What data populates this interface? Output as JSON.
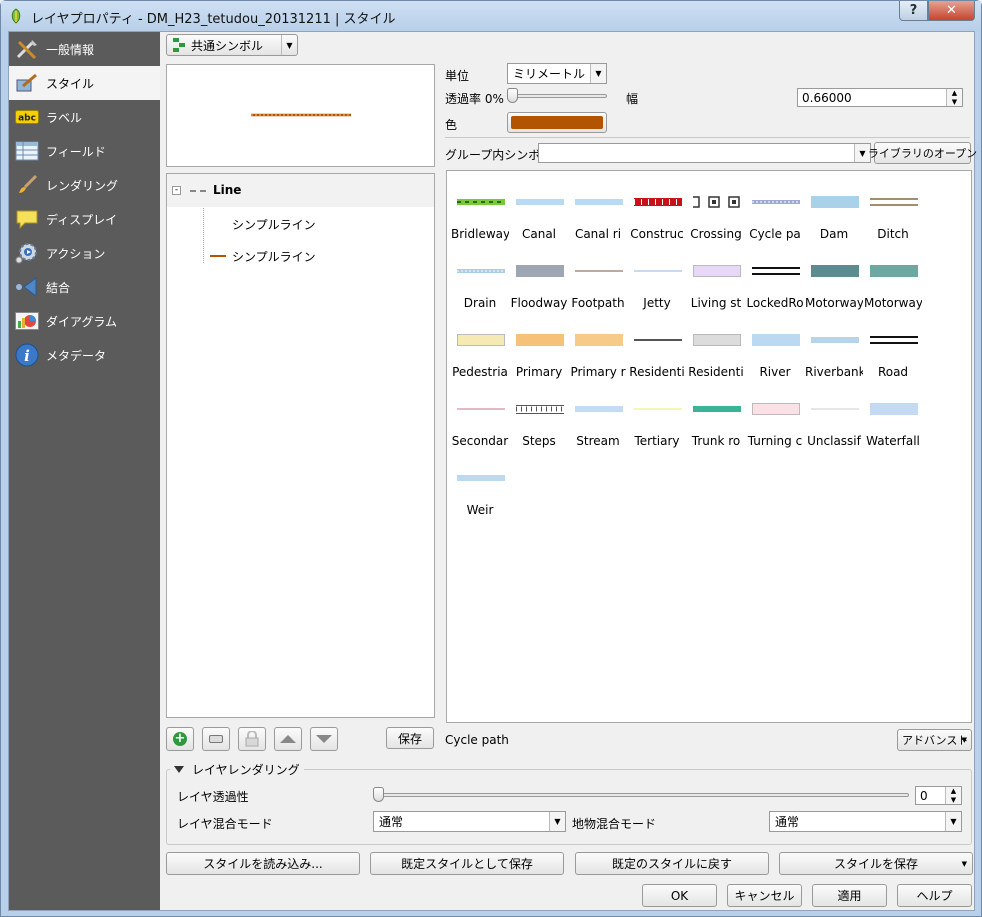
{
  "window": {
    "title": "レイヤプロパティ - DM_H23_tetudou_20131211 | スタイル",
    "help_label": "?",
    "close_label": "✕"
  },
  "sidebar": {
    "items": [
      {
        "label": "一般情報",
        "icon": "tools-icon"
      },
      {
        "label": "スタイル",
        "icon": "brush-style-icon"
      },
      {
        "label": "ラベル",
        "icon": "abc-label-icon"
      },
      {
        "label": "フィールド",
        "icon": "table-icon"
      },
      {
        "label": "レンダリング",
        "icon": "paintbrush-icon"
      },
      {
        "label": "ディスプレイ",
        "icon": "speech-bubble-icon"
      },
      {
        "label": "アクション",
        "icon": "gear-action-icon"
      },
      {
        "label": "結合",
        "icon": "join-arrow-icon"
      },
      {
        "label": "ダイアグラム",
        "icon": "diagram-icon"
      },
      {
        "label": "メタデータ",
        "icon": "info-icon"
      }
    ]
  },
  "renderer": {
    "type_label": "共通シンボル"
  },
  "tree": {
    "root": "Line",
    "children": [
      "シンプルライン",
      "シンプルライン"
    ]
  },
  "props": {
    "unit_label": "単位",
    "unit_value": "ミリメートル",
    "opacity_label": "透過率 0%",
    "width_label": "幅",
    "width_value": "0.66000",
    "color_label": "色",
    "color_value": "#b35400"
  },
  "group": {
    "label": "グループ内シンボル",
    "value": "",
    "library_button": "ライブラリのオープン"
  },
  "symbols": [
    {
      "name": "Bridleway",
      "color": "#78c83c",
      "style": "dash"
    },
    {
      "name": "Canal",
      "color": "#bcd9f2",
      "style": "solid"
    },
    {
      "name": "Canal ri",
      "color": "#bcd9f2",
      "style": "solid"
    },
    {
      "name": "Construc",
      "color": "#c8121a",
      "style": "blocks"
    },
    {
      "name": "Crossing",
      "color": "#333333",
      "style": "squares"
    },
    {
      "name": "Cycle pa",
      "color": "#a0a8d8",
      "style": "dots"
    },
    {
      "name": "Dam",
      "color": "#a9d2ea",
      "style": "thick"
    },
    {
      "name": "Ditch",
      "color": "#a58d70",
      "style": "double"
    },
    {
      "name": "Drain",
      "color": "#a8cfe0",
      "style": "dots"
    },
    {
      "name": "Floodway",
      "color": "#9ea6b4",
      "style": "thick"
    },
    {
      "name": "Footpath",
      "color": "#c0aaa0",
      "style": "thin"
    },
    {
      "name": "Jetty",
      "color": "#c8d8f0",
      "style": "thin"
    },
    {
      "name": "Living st",
      "color": "#e6d8f6",
      "style": "box"
    },
    {
      "name": "LockedRo",
      "color": "#111111",
      "style": "double"
    },
    {
      "name": "Motorway",
      "color": "#5d8c90",
      "style": "thick"
    },
    {
      "name": "Motorway",
      "color": "#6ea6a0",
      "style": "thick"
    },
    {
      "name": "Pedestria",
      "color": "#f6eab4",
      "style": "box"
    },
    {
      "name": "Primary",
      "color": "#f6c27a",
      "style": "thick"
    },
    {
      "name": "Primary r",
      "color": "#f8ca8a",
      "style": "thick"
    },
    {
      "name": "Residenti",
      "color": "#555555",
      "style": "thin"
    },
    {
      "name": "Residenti",
      "color": "#dcdcdc",
      "style": "box"
    },
    {
      "name": "River",
      "color": "#bcd9f2",
      "style": "thick"
    },
    {
      "name": "Riverbank",
      "color": "#b8d4ea",
      "style": "solid"
    },
    {
      "name": "Road",
      "color": "#111111",
      "style": "double"
    },
    {
      "name": "Secondar",
      "color": "#e6b8c4",
      "style": "thin"
    },
    {
      "name": "Steps",
      "color": "#555555",
      "style": "ticks"
    },
    {
      "name": "Stream",
      "color": "#c4dcf2",
      "style": "solid"
    },
    {
      "name": "Tertiary",
      "color": "#f6f6b8",
      "style": "thin"
    },
    {
      "name": "Trunk ro",
      "color": "#3ab496",
      "style": "solid"
    },
    {
      "name": "Turning c",
      "color": "#fbe0e6",
      "style": "box"
    },
    {
      "name": "Unclassif",
      "color": "#e6e6e6",
      "style": "thin"
    },
    {
      "name": "Waterfall",
      "color": "#c4daf2",
      "style": "thick"
    },
    {
      "name": "Weir",
      "color": "#bcd9f2",
      "style": "solid"
    }
  ],
  "selected_symbol_label": "Cycle path",
  "advanced_button": "アドバンスト",
  "save_button": "保存",
  "layer_rendering": {
    "header": "レイヤレンダリング",
    "opacity_label": "レイヤ透過性",
    "opacity_value": "0",
    "blend_label": "レイヤ混合モード",
    "blend_value": "通常",
    "feature_blend_label": "地物混合モード",
    "feature_blend_value": "通常"
  },
  "style_buttons": {
    "load": "スタイルを読み込み...",
    "save_default": "既定スタイルとして保存",
    "restore_default": "既定のスタイルに戻す",
    "save_style": "スタイルを保存"
  },
  "dialog_buttons": {
    "ok": "OK",
    "cancel": "キャンセル",
    "apply": "適用",
    "help": "ヘルプ"
  }
}
